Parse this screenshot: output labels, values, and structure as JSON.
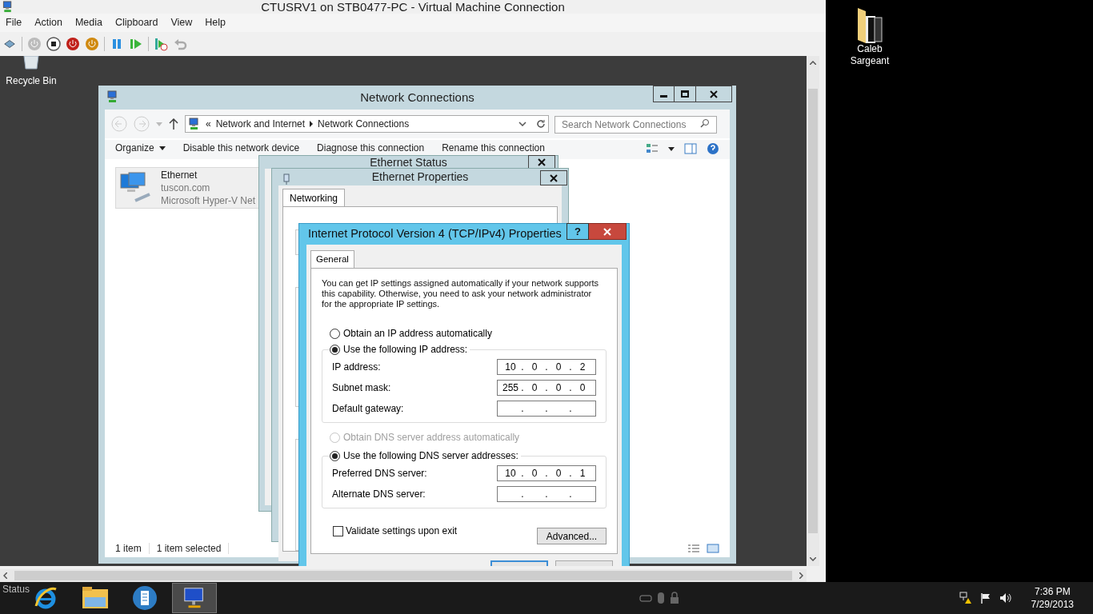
{
  "vm_window": {
    "title": "CTUSRV1 on STB0477-PC - Virtual Machine Connection",
    "menu": [
      "File",
      "Action",
      "Media",
      "Clipboard",
      "View",
      "Help"
    ],
    "status": "Status"
  },
  "guest": {
    "icons": [
      {
        "label": "Recycle Bin"
      }
    ]
  },
  "network_connections": {
    "title": "Network Connections",
    "breadcrumb_prefix": "«",
    "breadcrumb": [
      "Network and Internet",
      "Network Connections"
    ],
    "search": {
      "placeholder": "Search Network Connections"
    },
    "organize": "Organize",
    "commands": [
      "Disable this network device",
      "Diagnose this connection",
      "Rename this connection"
    ],
    "items": [
      {
        "name": "Ethernet",
        "domain": "tuscon.com",
        "adapter": "Microsoft Hyper-V Net",
        "selected": true
      }
    ],
    "status_bar": [
      "1 item",
      "1 item selected"
    ]
  },
  "ethernet_status": {
    "title": "Ethernet Status"
  },
  "ethernet_properties": {
    "title": "Ethernet Properties",
    "tabs": [
      {
        "label": "Networking",
        "selected": true
      }
    ]
  },
  "ipv4": {
    "title": "Internet Protocol Version 4 (TCP/IPv4) Properties",
    "help": "?",
    "tabs": [
      {
        "label": "General",
        "selected": true
      }
    ],
    "intro": "You can get IP settings assigned automatically if your network supports this capability. Otherwise, you need to ask your network administrator for the appropriate IP settings.",
    "octet_separator": ".",
    "ip_mode": [
      {
        "label": "Obtain an IP address automatically",
        "selected": false,
        "disabled": false
      },
      {
        "label": "Use the following IP address:",
        "selected": true,
        "disabled": false
      }
    ],
    "ip_fields": [
      {
        "label": "IP address:",
        "octets": [
          "10",
          "0",
          "0",
          "2"
        ]
      },
      {
        "label": "Subnet mask:",
        "octets": [
          "255",
          "0",
          "0",
          "0"
        ]
      },
      {
        "label": "Default gateway:"
      }
    ],
    "dns_mode": [
      {
        "label": "Obtain DNS server address automatically",
        "selected": false,
        "disabled": true
      },
      {
        "label": "Use the following DNS server addresses:",
        "selected": true,
        "disabled": false
      }
    ],
    "dns_fields": [
      {
        "label": "Preferred DNS server:",
        "octets": [
          "10",
          "0",
          "0",
          "1"
        ]
      },
      {
        "label": "Alternate DNS server:"
      }
    ],
    "validate": {
      "label": "Validate settings upon exit",
      "checked": false
    },
    "advanced": "Advanced..."
  },
  "host_desktop": {
    "icons": [
      {
        "label": "Caleb Sargeant"
      }
    ]
  },
  "taskbar": {
    "apps": [
      {
        "kind": "browser",
        "selected": false
      },
      {
        "kind": "file-explorer",
        "selected": false
      },
      {
        "kind": "server-manager",
        "selected": false
      },
      {
        "kind": "vm-connection",
        "selected": true
      }
    ],
    "time": "7:36 PM",
    "date": "7/29/2013"
  }
}
